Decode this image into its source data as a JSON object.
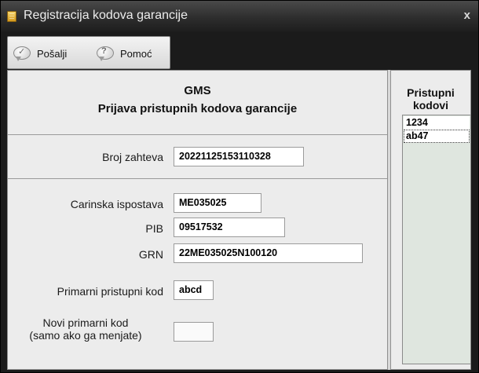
{
  "window": {
    "title": "Registracija kodova garancije",
    "close": "x"
  },
  "toolbar": {
    "send_label": "Pošalji",
    "help_label": "Pomoć"
  },
  "form": {
    "heading_line1": "GMS",
    "heading_line2": "Prijava pristupnih kodova garancije",
    "request_number_label": "Broj zahteva",
    "request_number_value": "20221125153110328",
    "customs_office_label": "Carinska ispostava",
    "customs_office_value": "ME035025",
    "pib_label": "PIB",
    "pib_value": "09517532",
    "grn_label": "GRN",
    "grn_value": "22ME035025N100120",
    "primary_code_label": "Primarni pristupni kod",
    "primary_code_value": "abcd",
    "new_primary_code_label_line1": "Novi primarni kod",
    "new_primary_code_label_line2": "(samo ako ga menjate)",
    "new_primary_code_value": ""
  },
  "side_panel": {
    "title_line1": "Pristupni",
    "title_line2": "kodovi",
    "codes": [
      "1234",
      "ab47"
    ]
  }
}
